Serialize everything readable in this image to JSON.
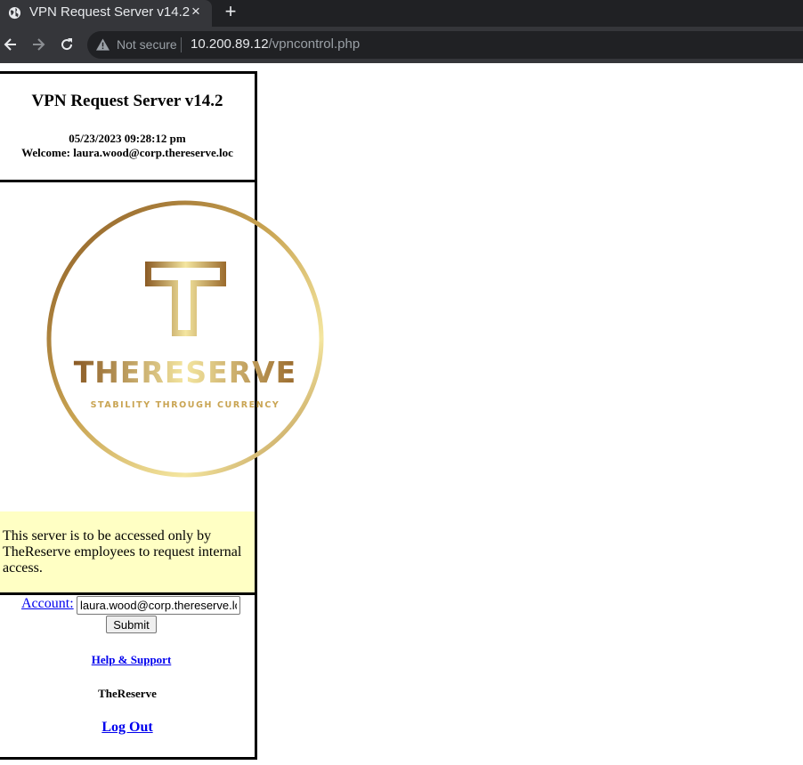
{
  "browser": {
    "tab_title": "VPN Request Server v14.2",
    "close_glyph": "×",
    "new_tab_glyph": "+",
    "security_label": "Not secure",
    "url_host": "10.200.89.12",
    "url_path": "/vpncontrol.php",
    "icons": [
      "globe-icon",
      "back-arrow-icon",
      "forward-arrow-icon",
      "reload-icon",
      "warning-icon"
    ]
  },
  "header": {
    "title": "VPN Request Server v14.2",
    "datetime": "05/23/2023 09:28:12 pm",
    "welcome": "Welcome: laura.wood@corp.thereserve.loc"
  },
  "logo": {
    "brand": "THERESERVE",
    "tagline": "STABILITY THROUGH CURRENCY",
    "colors": {
      "gold_light": "#f4e6a0",
      "gold_dark": "#8a5a24"
    }
  },
  "notice": {
    "text": "This server is to be accessed only by TheReserve employees to request internal access.",
    "background": "#ffffc4"
  },
  "form": {
    "account_label": "Account:",
    "account_value": "laura.wood@corp.thereserve.loc",
    "submit_label": "Submit"
  },
  "footer": {
    "help_link": "Help & Support",
    "brand_name": "TheReserve",
    "logout_link": "Log Out"
  }
}
